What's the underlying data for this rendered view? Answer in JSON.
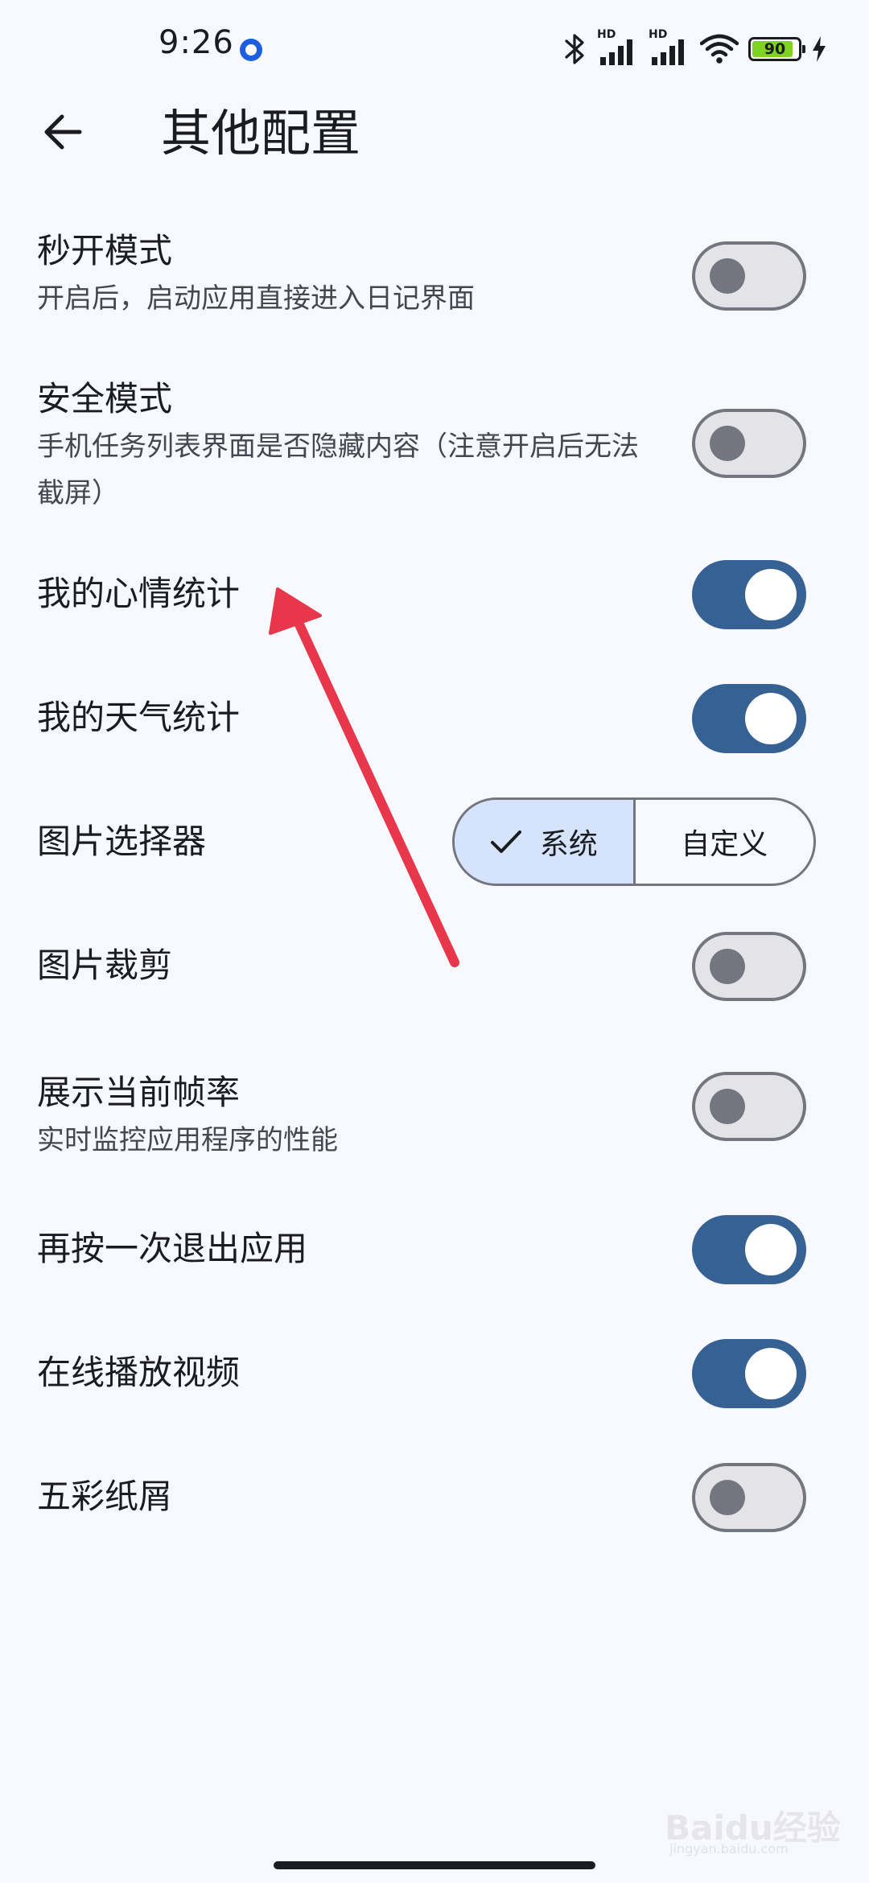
{
  "status_bar": {
    "time": "9:26",
    "hd_label_1": "HD",
    "hd_label_2": "HD",
    "battery_level": 90,
    "battery_text": "90",
    "icons": [
      "app-notification-icon",
      "bluetooth-icon",
      "signal-icon",
      "wifi-icon",
      "battery-icon",
      "charging-icon"
    ]
  },
  "header": {
    "title": "其他配置",
    "back_icon": "arrow-left-icon"
  },
  "settings": [
    {
      "id": "quick-open",
      "title": "秒开模式",
      "subtitle": "开启后，启动应用直接进入日记界面",
      "enabled": false
    },
    {
      "id": "safe-mode",
      "title": "安全模式",
      "subtitle": "手机任务列表界面是否隐藏内容（注意开启后无法截屏）",
      "enabled": false
    },
    {
      "id": "mood-stats",
      "title": "我的心情统计",
      "enabled": true
    },
    {
      "id": "weather-stats",
      "title": "我的天气统计",
      "enabled": true
    },
    {
      "id": "image-picker",
      "title": "图片选择器",
      "type": "segmented",
      "options": [
        "系统",
        "自定义"
      ],
      "selected": "系统"
    },
    {
      "id": "image-crop",
      "title": "图片裁剪",
      "enabled": false
    },
    {
      "id": "show-fps",
      "title": "展示当前帧率",
      "subtitle": "实时监控应用程序的性能",
      "enabled": false
    },
    {
      "id": "double-back-exit",
      "title": "再按一次退出应用",
      "enabled": true
    },
    {
      "id": "online-video",
      "title": "在线播放视频",
      "enabled": true
    },
    {
      "id": "confetti",
      "title": "五彩纸屑",
      "enabled": false
    }
  ],
  "colors": {
    "background": "#f8f9ff",
    "switch_on": "#366193",
    "switch_off_track": "#e3e3e8",
    "switch_off_outline": "#74767f",
    "segment_selected": "#d5e3fb",
    "annotation_arrow": "#e8374a"
  },
  "watermark": {
    "text": "Baidu经验",
    "sub": "jingyan.baidu.com"
  }
}
